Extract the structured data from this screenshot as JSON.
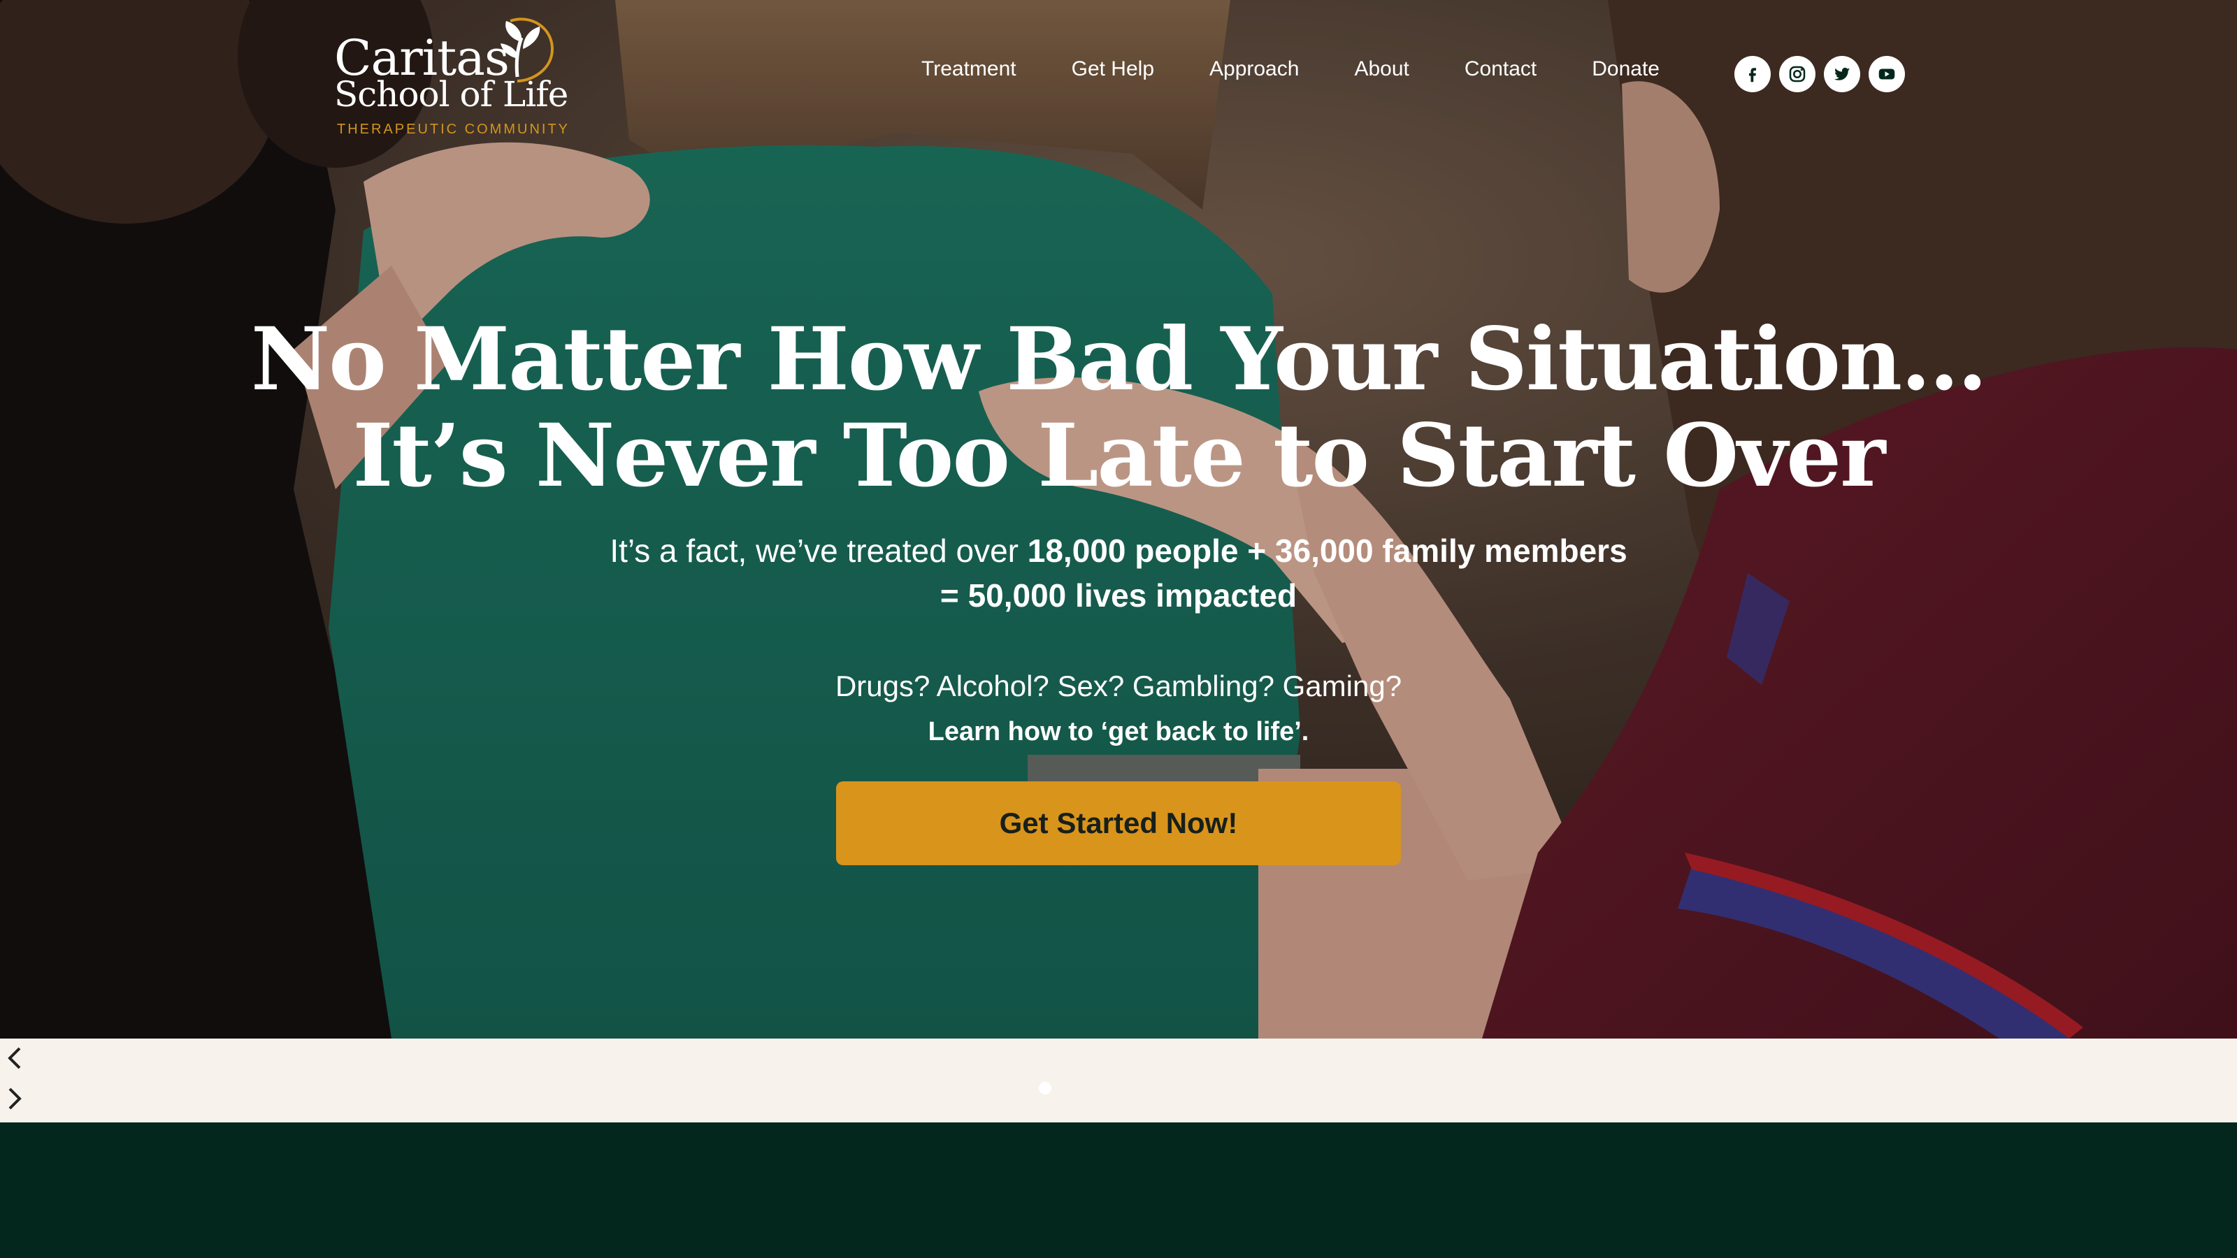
{
  "logo": {
    "line1": "Caritas",
    "line2": "School of Life",
    "line3": "THERAPEUTIC COMMUNITY"
  },
  "nav": {
    "items": [
      "Treatment",
      "Get Help",
      "Approach",
      "About",
      "Contact",
      "Donate"
    ]
  },
  "social": {
    "icons": [
      "facebook-icon",
      "instagram-icon",
      "twitter-icon",
      "youtube-icon"
    ]
  },
  "hero": {
    "headline_line1": "No Matter How Bad Your Situation…",
    "headline_line2": "It’s Never Too Late to Start Over",
    "fact_prefix": "It’s a fact, we’ve treated over ",
    "fact_bold": "18,000 people + 36,000 family members",
    "fact_line2": "= 50,000 lives impacted",
    "question": "Drugs? Alcohol? Sex? Gambling? Gaming?",
    "learn": "Learn how to ‘get back to life’.",
    "cta": "Get Started Now!"
  },
  "colors": {
    "accent": "#d9941c",
    "brand_green": "#03271d",
    "slider_bar": "#f7f3ec"
  }
}
